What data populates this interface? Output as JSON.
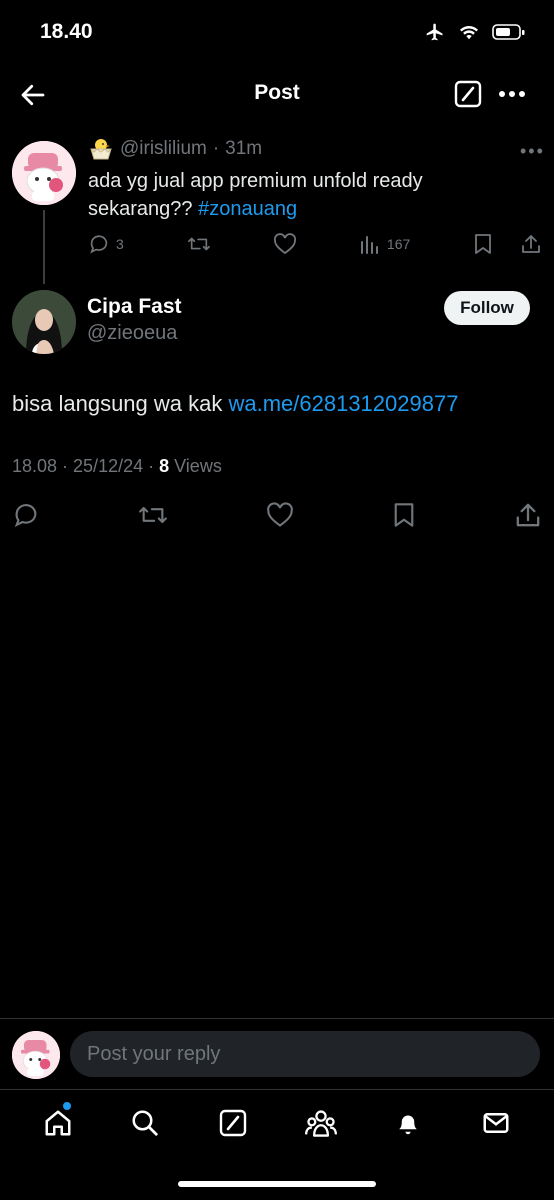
{
  "status_bar": {
    "time": "18.40"
  },
  "header": {
    "title": "Post"
  },
  "parent_tweet": {
    "handle": "@irislilium",
    "time_sep": "·",
    "time": "31m",
    "text_main": "ada yg jual app premium unfold ready sekarang?? ",
    "hashtag": "#zonauang",
    "replies": "3",
    "views": "167"
  },
  "main_tweet": {
    "author_name": "Cipa Fast",
    "author_handle": "@zieoeua",
    "follow_label": "Follow",
    "text_main": "bisa langsung wa kak ",
    "link": "wa.me/6281312029877",
    "timestamp": "18.08 · 25/12/24 · ",
    "views_count": "8",
    "views_label": " Views"
  },
  "reply_bar": {
    "placeholder": "Post your reply"
  },
  "colors": {
    "accent": "#1d9bf0",
    "muted": "#71767b",
    "background": "#000000"
  },
  "icons": [
    "back-arrow-icon",
    "grok-icon",
    "more-icon",
    "reply-icon",
    "retweet-icon",
    "like-icon",
    "views-icon",
    "bookmark-icon",
    "share-icon",
    "home-icon",
    "search-icon",
    "grok-nav-icon",
    "communities-icon",
    "notifications-icon",
    "messages-icon"
  ]
}
